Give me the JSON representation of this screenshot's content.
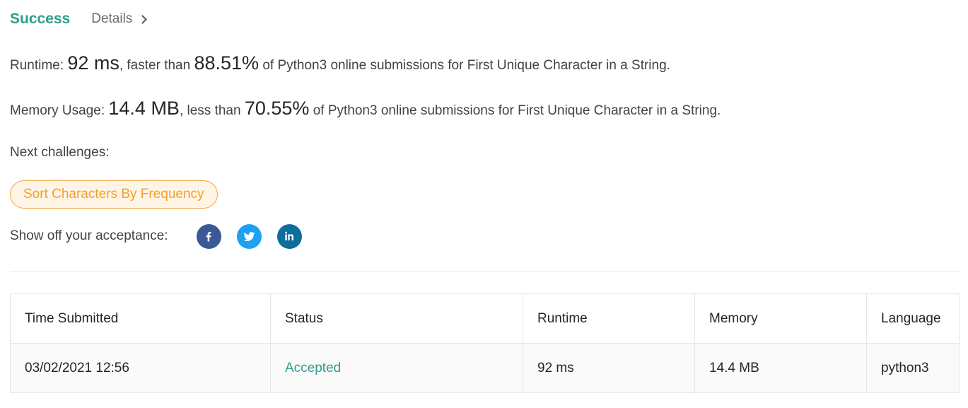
{
  "header": {
    "status": "Success",
    "details_label": "Details"
  },
  "runtime": {
    "label": "Runtime:",
    "value": "92 ms",
    "comparison": ", faster than",
    "percent": "88.51%",
    "suffix": "of Python3 online submissions for First Unique Character in a String."
  },
  "memory": {
    "label": "Memory Usage:",
    "value": "14.4 MB",
    "comparison": ", less than",
    "percent": "70.55%",
    "suffix": "of Python3 online submissions for First Unique Character in a String."
  },
  "next_challenges": {
    "label": "Next challenges:",
    "items": [
      "Sort Characters By Frequency"
    ]
  },
  "share": {
    "label": "Show off your acceptance:",
    "networks": [
      {
        "icon": "facebook-icon",
        "color": "#3b5998"
      },
      {
        "icon": "twitter-icon",
        "color": "#1da1f2"
      },
      {
        "icon": "linkedin-icon",
        "color": "#0077b5"
      }
    ]
  },
  "submissions": {
    "columns": [
      "Time Submitted",
      "Status",
      "Runtime",
      "Memory",
      "Language"
    ],
    "rows": [
      [
        "03/02/2021 12:56",
        "Accepted",
        "92 ms",
        "14.4 MB",
        "python3"
      ]
    ]
  },
  "colors": {
    "success": "#2e9e8a",
    "challenge_border": "#f0a64a",
    "challenge_text": "#f0a030"
  }
}
